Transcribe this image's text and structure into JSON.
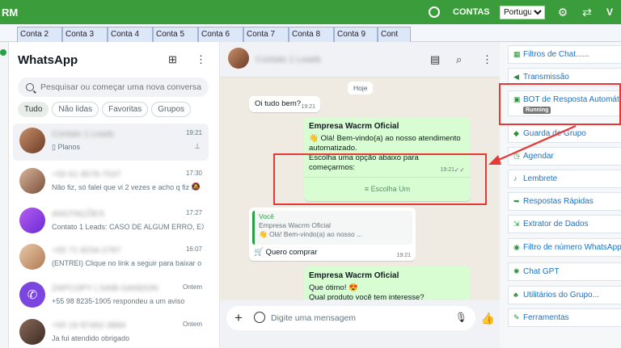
{
  "topbar": {
    "brand": "RM",
    "contas": "CONTAS",
    "language": "Portuguese",
    "right_letter": "V"
  },
  "tabs": [
    "Conta 2",
    "Conta 3",
    "Conta 4",
    "Conta 5",
    "Conta 6",
    "Conta 7",
    "Conta 8",
    "Conta 9",
    "Cont"
  ],
  "chatlist": {
    "title": "WhatsApp",
    "search_placeholder": "Pesquisar ou começar uma nova conversa",
    "filters": [
      "Tudo",
      "Não lidas",
      "Favoritas",
      "Grupos"
    ],
    "chats": [
      {
        "name": "Contato 1 Leads",
        "time": "19:21",
        "message": "Planos",
        "side": "pin-icon",
        "blurred": true
      },
      {
        "name": "+55 61 9578-7537",
        "time": "17:30",
        "message": "Não fiz, só falei que vi 2 vezes e acho q fiz ...",
        "side": "muted-icon",
        "blurred": true
      },
      {
        "name": "ANOTAÇÕES",
        "time": "17:27",
        "message": "Contato 1 Leads: CASO DE ALGUM ERRO, EXE...",
        "side": "",
        "blurred": true
      },
      {
        "name": "+55 71 8234-2787",
        "time": "16:07",
        "message": "(ENTREI) Clique no link a seguir para baixar o ...",
        "side": "",
        "blurred": true
      },
      {
        "name": "ZAPCOPY | SAIB GANDON",
        "time": "Ontem",
        "message": "+55 98 8235-1905 respondeu a um aviso",
        "side": "",
        "blurred": true
      },
      {
        "name": "+55 19 97462-3884",
        "time": "Ontem",
        "message": "Ja fui atendido obrigado",
        "side": "",
        "blurred": true
      }
    ]
  },
  "conversation": {
    "contact_name": "Contato 1 Leads",
    "date_label": "Hoje",
    "messages": {
      "m1": {
        "text": "Oi tudo bem?",
        "time": "19:21"
      },
      "m2": {
        "title": "Empresa Wacrm Oficial",
        "line1": "👋 Olá! Bem-vindo(a) ao nosso atendimento automatizado.",
        "line2": "Escolha uma opção abaixo para começarmos:",
        "time": "19:21",
        "button": "≡  Escolha Um"
      },
      "m3": {
        "quote_author": "Você",
        "quote_title": "Empresa Wacrm Oficial",
        "quote_text": "👋 Olá! Bem-vindo(a) ao nosso ...",
        "text": "🛒 Quero comprar",
        "time": "19:21"
      },
      "m4": {
        "title": "Empresa Wacrm Oficial",
        "line1": "Que ótimo! 😍",
        "line2": "Qual produto você tem interesse?"
      }
    },
    "composer_placeholder": "Digite uma mensagem"
  },
  "rightmenu": {
    "items": [
      "Filtros de Chat......",
      "Transmissão",
      "BOT de Resposta Automática",
      "Guarda de Grupo",
      "Agendar",
      "Lembrete",
      "Respostas Rápidas",
      "Extrator de Dados",
      "Filtro de número WhatsApp",
      "Chat GPT",
      "Utilitários do Grupo...",
      "Ferramentas"
    ],
    "running_badge": "Running"
  },
  "colors": {
    "topbar": "#3b9c3b",
    "accent_link": "#1a73c9",
    "outgoing_bubble": "#d9fdd3",
    "annotation_red": "#e53935"
  }
}
